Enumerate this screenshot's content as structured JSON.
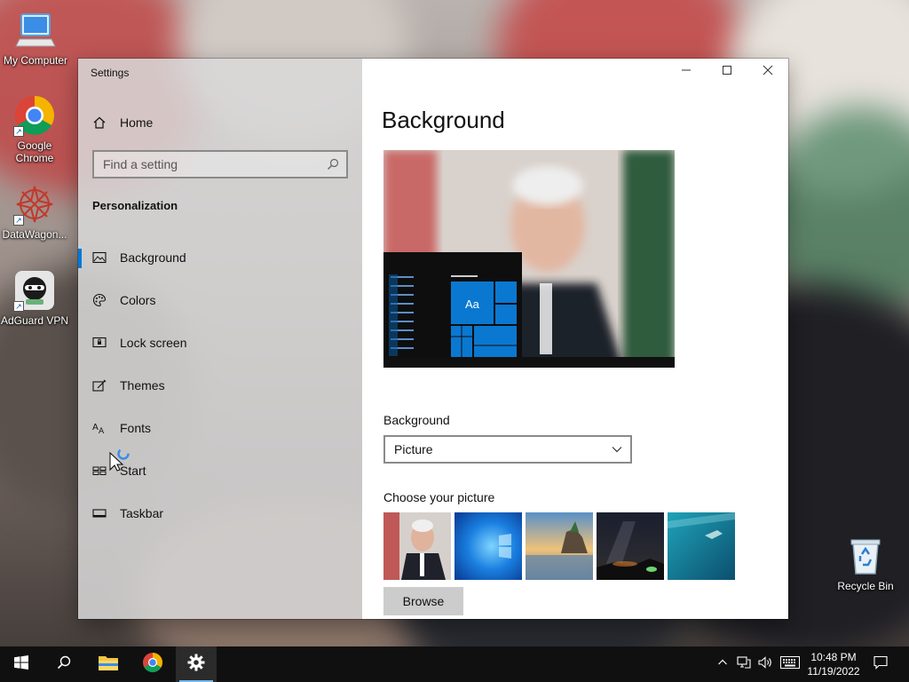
{
  "desktop": {
    "icons": [
      {
        "label": "My Computer",
        "icon": "computer-icon"
      },
      {
        "label": "Google Chrome",
        "icon": "chrome-icon"
      },
      {
        "label": "DataWagon...",
        "icon": "datawagon-icon"
      },
      {
        "label": "AdGuard VPN",
        "icon": "adguard-vpn-icon"
      },
      {
        "label": "Recycle Bin",
        "icon": "recycle-bin-icon"
      }
    ]
  },
  "window": {
    "title": "Settings",
    "controls": {
      "minimize": "minimize-icon",
      "maximize": "maximize-icon",
      "close": "close-icon"
    }
  },
  "sidebar": {
    "home_label": "Home",
    "search_placeholder": "Find a setting",
    "section": "Personalization",
    "items": [
      {
        "label": "Background",
        "icon": "picture-icon",
        "selected": true
      },
      {
        "label": "Colors",
        "icon": "palette-icon",
        "selected": false
      },
      {
        "label": "Lock screen",
        "icon": "lock-screen-icon",
        "selected": false
      },
      {
        "label": "Themes",
        "icon": "themes-icon",
        "selected": false
      },
      {
        "label": "Fonts",
        "icon": "fonts-icon",
        "selected": false
      },
      {
        "label": "Start",
        "icon": "start-icon",
        "selected": false
      },
      {
        "label": "Taskbar",
        "icon": "taskbar-icon",
        "selected": false
      }
    ]
  },
  "content": {
    "title": "Background",
    "preview_tile_label": "Aa",
    "background_label": "Background",
    "background_value": "Picture",
    "choose_label": "Choose your picture",
    "browse_label": "Browse"
  },
  "taskbar": {
    "time": "10:48 PM",
    "date": "11/19/2022"
  },
  "colors": {
    "accent": "#0078d7",
    "taskbar": "#101010",
    "tile_blue": "#0a78d1"
  }
}
